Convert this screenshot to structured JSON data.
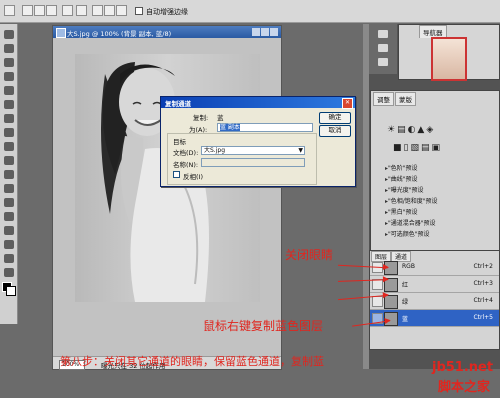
{
  "doc": {
    "title": "大S.jpg @ 100% (背景 副本, 蓝/8)",
    "zoom": "100%",
    "status": "曝光只在 32 位起作用"
  },
  "options": {
    "auto_enhance": "自动增强边缘"
  },
  "navigator": {
    "tab": "导航器"
  },
  "adjustments": {
    "tabs": [
      "调整",
      "蒙版"
    ],
    "presets": [
      "\"色阶\"预设",
      "\"曲线\"预设",
      "\"曝光度\"预设",
      "\"色相/饱和度\"预设",
      "\"黑白\"预设",
      "\"通道混合器\"预设",
      "\"可选颜色\"预设"
    ]
  },
  "channels": {
    "tabs": [
      "图层",
      "通道"
    ],
    "rows": [
      {
        "name": "RGB",
        "shortcut": "Ctrl+2"
      },
      {
        "name": "红",
        "shortcut": "Ctrl+3"
      },
      {
        "name": "绿",
        "shortcut": "Ctrl+4"
      },
      {
        "name": "蓝",
        "shortcut": "Ctrl+5"
      }
    ]
  },
  "dialog": {
    "title": "复制通道",
    "copy_label": "复制:",
    "copy_value": "蓝",
    "as_label": "为(A):",
    "as_value": "蓝 副本",
    "target_label": "目标",
    "doc_label": "文档(D):",
    "doc_value": "大S.jpg",
    "name_label": "名称(N):",
    "name_value": "",
    "invert_label": "反相(I)",
    "ok": "确定",
    "cancel": "取消"
  },
  "annotations": {
    "close_eyes": "关闭眼睛",
    "right_click": "鼠标右键复制蓝色图层",
    "step": "第八步：关闭其它通道的眼睛，保留蓝色通道，复制蓝",
    "watermark_url": "jb51.net",
    "watermark_cn": "脚本之家"
  },
  "colors": {
    "accent": "#e0261f",
    "selection": "#2f63c4"
  }
}
